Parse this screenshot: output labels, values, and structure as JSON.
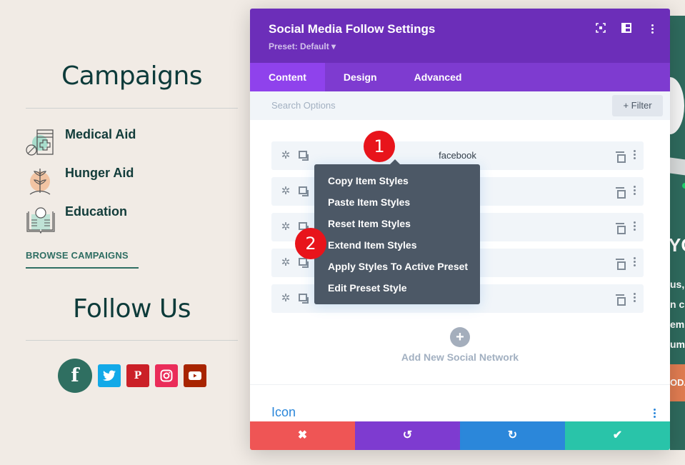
{
  "page": {
    "campaigns": {
      "title": "Campaigns",
      "items": [
        {
          "label": "Medical Aid",
          "icon": "medicine-bottle-icon"
        },
        {
          "label": "Hunger Aid",
          "icon": "plant-sprout-icon"
        },
        {
          "label": "Education",
          "icon": "open-book-lightbulb-icon"
        }
      ],
      "browse_link": "BROWSE CAMPAIGNS"
    },
    "follow": {
      "title": "Follow Us",
      "networks": [
        {
          "name": "facebook",
          "glyph": "f",
          "color": "#2f6f61"
        },
        {
          "name": "twitter",
          "glyph": "🐦",
          "color": "#13a9e8"
        },
        {
          "name": "pinterest",
          "glyph": "P",
          "color": "#cb2027"
        },
        {
          "name": "instagram",
          "glyph": "◎",
          "color": "#ea2c59"
        },
        {
          "name": "youtube",
          "glyph": "▶",
          "color": "#a82400"
        }
      ]
    },
    "right_strip": {
      "heading_fragment": "YO",
      "text_lines": [
        "us,",
        "n c",
        "em",
        "um."
      ],
      "button_fragment": "ODA"
    }
  },
  "modal": {
    "title": "Social Media Follow Settings",
    "preset": "Preset: Default ▾",
    "header_icons": [
      "focus-icon",
      "split-view-icon",
      "more-vertical-icon"
    ],
    "tabs": [
      {
        "label": "Content",
        "active": true
      },
      {
        "label": "Design",
        "active": false
      },
      {
        "label": "Advanced",
        "active": false
      }
    ],
    "search": {
      "placeholder": "Search Options",
      "value": ""
    },
    "filter_label": "+ Filter",
    "items": [
      {
        "name": "facebook"
      },
      {
        "name": ""
      },
      {
        "name": ""
      },
      {
        "name": ""
      },
      {
        "name": ""
      }
    ],
    "add_new_label": "Add New Social Network",
    "section_label": "Icon",
    "footer": {
      "cancel": "✖",
      "undo": "↺",
      "redo": "↻",
      "save": "✔"
    }
  },
  "context_menu": {
    "items": [
      "Copy Item Styles",
      "Paste Item Styles",
      "Reset Item Styles",
      "Extend Item Styles",
      "Apply Styles To Active Preset",
      "Edit Preset Style"
    ]
  },
  "annotations": [
    {
      "number": "1",
      "color": "#e8141b"
    },
    {
      "number": "2",
      "color": "#e8141b"
    }
  ]
}
